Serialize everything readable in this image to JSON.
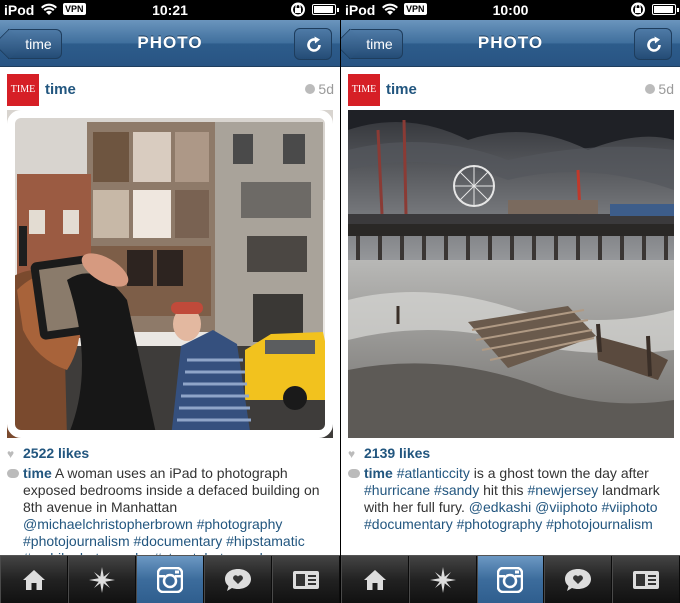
{
  "screens": [
    {
      "status": {
        "carrier": "iPod",
        "vpn": "VPN",
        "time": "10:21",
        "battery_level": 0.95
      },
      "nav": {
        "back_label": "time",
        "title": "PHOTO"
      },
      "post": {
        "username": "time",
        "logo_text": "TIME",
        "age": "5d",
        "likes": "2522 likes",
        "caption_author": "time",
        "caption_text": "A woman uses an iPad to photograph exposed bedrooms inside a defaced building on 8th avenue in Manhattan",
        "caption_tags": "@michaelchristopherbrown #photography #photojournalism #documentary #hipstamatic #mobilephotography #streetphotography"
      }
    },
    {
      "status": {
        "carrier": "iPod",
        "vpn": "VPN",
        "time": "10:00",
        "battery_level": 0.95
      },
      "nav": {
        "back_label": "time",
        "title": "PHOTO"
      },
      "post": {
        "username": "time",
        "logo_text": "TIME",
        "age": "5d",
        "likes": "2139 likes",
        "caption_author": "time",
        "caption_parts": [
          "#atlanticcity",
          " is a ghost town the day after ",
          "#hurricane",
          " ",
          "#sandy",
          " hit this ",
          "#newjersey",
          " landmark with her full fury. ",
          "@edkashi",
          " ",
          "@viiphoto",
          " ",
          "#viiphoto",
          " ",
          "#documentary",
          " ",
          "#photography",
          " ",
          "#photojournalism"
        ]
      }
    }
  ],
  "tabs": [
    {
      "name": "home",
      "icon": "house-icon"
    },
    {
      "name": "explore",
      "icon": "star-icon"
    },
    {
      "name": "camera",
      "icon": "camera-icon",
      "active": true
    },
    {
      "name": "news",
      "icon": "speech-bubble-heart-icon"
    },
    {
      "name": "profile",
      "icon": "id-card-icon"
    }
  ],
  "colors": {
    "nav_blue": "#3f6f9d",
    "link_blue": "#22567f",
    "time_red": "#d61f26"
  }
}
